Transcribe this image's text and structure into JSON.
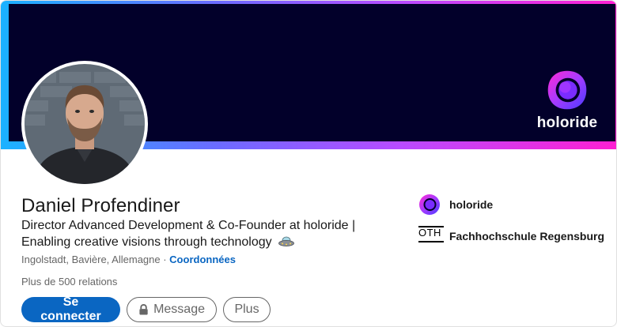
{
  "banner": {
    "brand_text": "holoride",
    "colors": {
      "background": "#02002a",
      "gradient_start": "#1ab2ff",
      "gradient_end": "#ff1fd2"
    }
  },
  "profile": {
    "name": "Daniel Profendiner",
    "headline_line1": "Director Advanced Development & Co-Founder at holoride |",
    "headline_line2": "Enabling creative visions through technology",
    "headline_icon": "ufo-icon",
    "location": "Ingolstadt, Bavière, Allemagne",
    "separator": " · ",
    "contact_link": "Coordonnées",
    "connections": "Plus de 500 relations"
  },
  "actions": {
    "connect_label": "Se connecter",
    "message_label": "Message",
    "message_icon": "lock-icon",
    "more_label": "Plus"
  },
  "sidebar": {
    "items": [
      {
        "label": "holoride",
        "icon": "holoride-logo"
      },
      {
        "label": "Fachhochschule Regensburg",
        "icon": "oth-logo",
        "logo_text": "OTH"
      }
    ]
  },
  "colors": {
    "primary": "#0a66c2",
    "text": "#191919",
    "muted": "#666666"
  }
}
